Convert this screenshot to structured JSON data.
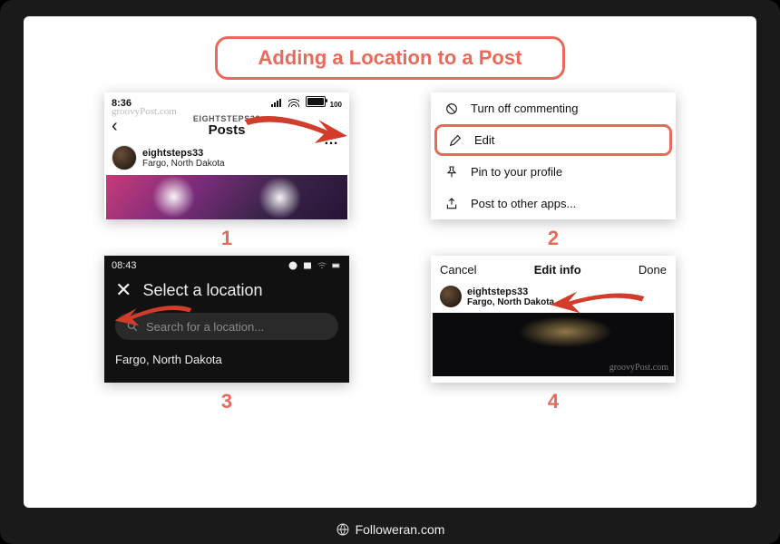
{
  "title": "Adding  a Location to a Post",
  "footer": "Followeran.com",
  "steps": [
    "1",
    "2",
    "3",
    "4"
  ],
  "panel1": {
    "time": "8:36",
    "battery": "100",
    "watermark": "groovyPost.com",
    "username_caps": "EIGHTSTEPS33",
    "heading": "Posts",
    "username": "eightsteps33",
    "location": "Fargo, North Dakota"
  },
  "panel2": {
    "items": [
      "Turn off commenting",
      "Edit",
      "Pin to your profile",
      "Post to other apps..."
    ]
  },
  "panel3": {
    "time": "08:43",
    "title": "Select a location",
    "placeholder": "Search for a location...",
    "result": "Fargo, North Dakota"
  },
  "panel4": {
    "cancel": "Cancel",
    "title": "Edit info",
    "done": "Done",
    "username": "eightsteps33",
    "location": "Fargo, North Dakota",
    "watermark": "groovyPost.com"
  }
}
